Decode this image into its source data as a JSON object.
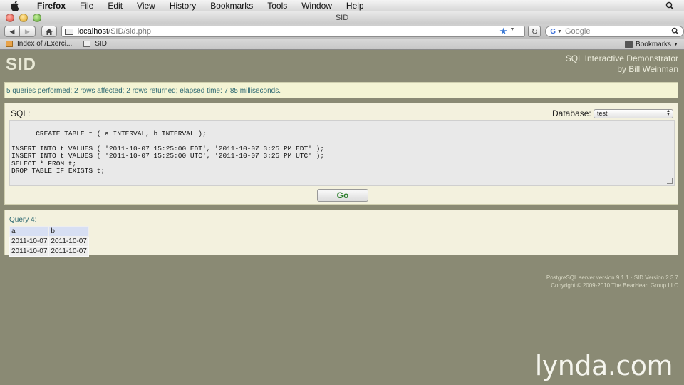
{
  "menubar": {
    "app": "Firefox",
    "items": [
      "File",
      "Edit",
      "View",
      "History",
      "Bookmarks",
      "Tools",
      "Window",
      "Help"
    ]
  },
  "window": {
    "title": "SID"
  },
  "toolbar": {
    "url_host": "localhost",
    "url_path": "/SID/sid.php",
    "search_placeholder": "Google"
  },
  "bookmarks": {
    "items": [
      {
        "label": "Index of /Exerci...",
        "icon": "folder-page-icon"
      },
      {
        "label": "SID",
        "icon": "page-icon"
      }
    ],
    "menu_label": "Bookmarks"
  },
  "header": {
    "logo": "SID",
    "subtitle_line1": "SQL Interactive Demonstrator",
    "subtitle_line2": "by Bill Weinman"
  },
  "status": {
    "message": "5 queries performed; 2 rows affected; 2 rows returned; elapsed time: 7.85 milliseconds."
  },
  "sql": {
    "label": "SQL:",
    "database_label": "Database:",
    "database_value": "test",
    "query_text": "CREATE TABLE t ( a INTERVAL, b INTERVAL );\n\nINSERT INTO t VALUES ( '2011-10-07 15:25:00 EDT', '2011-10-07 3:25 PM EDT' );\nINSERT INTO t VALUES ( '2011-10-07 15:25:00 UTC', '2011-10-07 3:25 PM UTC' );\nSELECT * FROM t;\nDROP TABLE IF EXISTS t;",
    "go_label": "Go"
  },
  "result": {
    "title": "Query 4:",
    "columns": [
      "a",
      "b"
    ],
    "rows": [
      [
        "2011-10-07",
        "2011-10-07"
      ],
      [
        "2011-10-07",
        "2011-10-07"
      ]
    ]
  },
  "footer": {
    "line1": "PostgreSQL server version 9.1.1 · SID Version 2.3.7",
    "line2": "Copyright © 2009-2010 The BearHeart Group LLC"
  },
  "watermark": {
    "text": "lynda.com"
  }
}
